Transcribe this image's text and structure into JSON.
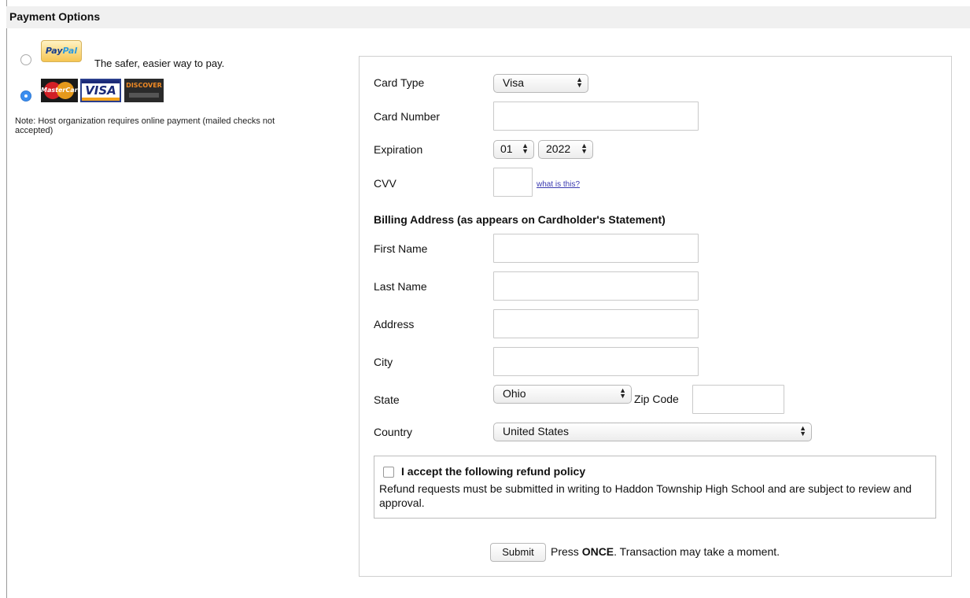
{
  "header": {
    "title": "Payment Options"
  },
  "payment_methods": {
    "paypal": {
      "logo_pay": "Pay",
      "logo_pal": "Pal",
      "tagline": "The safer, easier way to pay.",
      "selected": false
    },
    "cards": {
      "mastercard_logo": "MasterCard",
      "visa_logo": "VISA",
      "discover_logo": "DISCOVER",
      "selected": true
    },
    "note": "Note: Host organization requires online payment (mailed checks not accepted)"
  },
  "form": {
    "card_type": {
      "label": "Card Type",
      "value": "Visa"
    },
    "card_number": {
      "label": "Card Number",
      "value": ""
    },
    "expiration": {
      "label": "Expiration",
      "month": "01",
      "year": "2022"
    },
    "cvv": {
      "label": "CVV",
      "value": "",
      "help_link": "what is this?"
    },
    "billing_heading": "Billing Address (as appears on Cardholder's Statement)",
    "first_name": {
      "label": "First Name",
      "value": ""
    },
    "last_name": {
      "label": "Last Name",
      "value": ""
    },
    "address": {
      "label": "Address",
      "value": ""
    },
    "city": {
      "label": "City",
      "value": ""
    },
    "state": {
      "label": "State",
      "value": "Ohio"
    },
    "zip": {
      "label": "Zip Code",
      "value": ""
    },
    "country": {
      "label": "Country",
      "value": "United States"
    }
  },
  "refund_policy": {
    "checkbox_label": "I accept the following refund policy",
    "checked": false,
    "text": "Refund requests must be submitted in writing to Haddon Township High School and are subject to review and approval."
  },
  "submit": {
    "button_label": "Submit",
    "note_prefix": "Press",
    "note_emphasis": "ONCE",
    "note_suffix": ". Transaction may take a moment."
  }
}
